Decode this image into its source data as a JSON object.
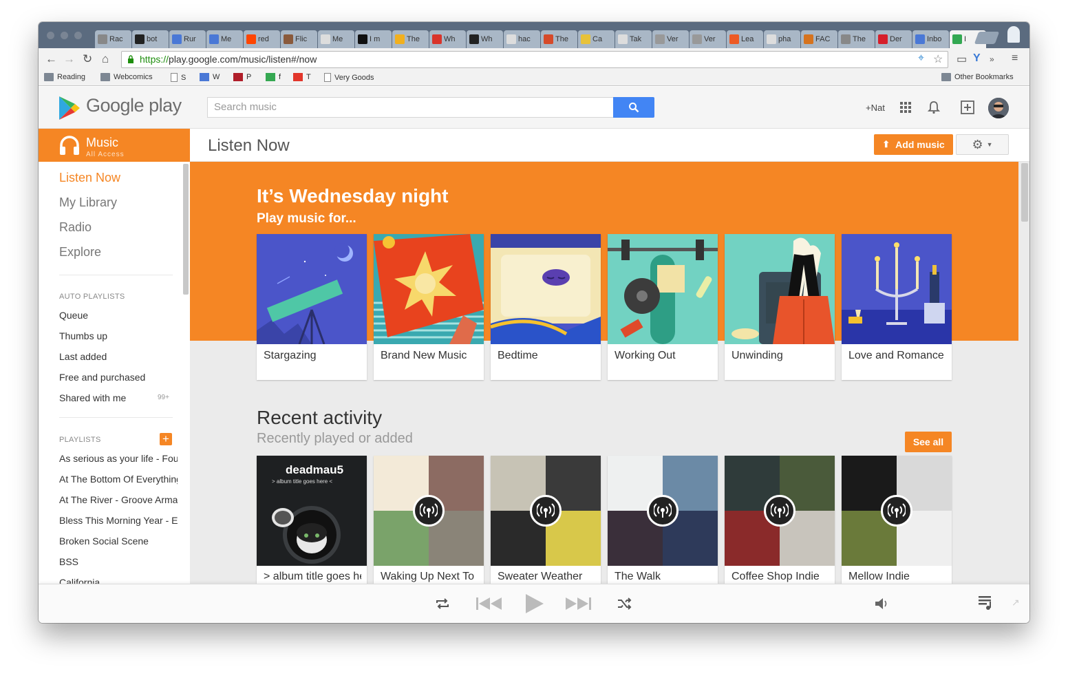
{
  "browser": {
    "tabs": [
      {
        "label": "Rac",
        "fav": "#888888"
      },
      {
        "label": "bot",
        "fav": "#222222"
      },
      {
        "label": "Rur",
        "fav": "#4a78d6"
      },
      {
        "label": "Me",
        "fav": "#4a78d6"
      },
      {
        "label": "red",
        "fav": "#ff4500"
      },
      {
        "label": "Flic",
        "fav": "#8a5a3c"
      },
      {
        "label": "Me",
        "fav": "#dddddd"
      },
      {
        "label": "I m",
        "fav": "#111111"
      },
      {
        "label": "The",
        "fav": "#f2b01e"
      },
      {
        "label": "Wh",
        "fav": "#d9342b"
      },
      {
        "label": "Wh",
        "fav": "#222222"
      },
      {
        "label": "hac",
        "fav": "#dddddd"
      },
      {
        "label": "The",
        "fav": "#d64a2a"
      },
      {
        "label": "Ca",
        "fav": "#e8c23a"
      },
      {
        "label": "Tak",
        "fav": "#dddddd"
      },
      {
        "label": "Ver",
        "fav": "#999999"
      },
      {
        "label": "Ver",
        "fav": "#999999"
      },
      {
        "label": "Lea",
        "fav": "#ee5a24"
      },
      {
        "label": "pha",
        "fav": "#dddddd"
      },
      {
        "label": "FAC",
        "fav": "#d6731e"
      },
      {
        "label": "The",
        "fav": "#888888"
      },
      {
        "label": "Der",
        "fav": "#d61e2a"
      },
      {
        "label": "Inbo",
        "fav": "#4a78d6"
      },
      {
        "label": "I",
        "fav": "#33a852"
      }
    ],
    "url_scheme": "https://",
    "url_rest": "play.google.com/music/listen#/now",
    "bookmarks": [
      {
        "label": "Reading",
        "icon": "folder-icon"
      },
      {
        "label": "Webcomics",
        "icon": "folder-icon"
      },
      {
        "label": "S",
        "icon": "page-icon"
      },
      {
        "label": "W",
        "icon": "doc-icon"
      },
      {
        "label": "P",
        "icon": "red-icon"
      },
      {
        "label": "f",
        "icon": "green-icon"
      },
      {
        "label": "T",
        "icon": "td-icon"
      },
      {
        "label": "Very Goods",
        "icon": "page-icon"
      }
    ],
    "other_bookmarks": "Other Bookmarks"
  },
  "header": {
    "logo_word1": "Google",
    "logo_word2": "play",
    "search_placeholder": "Search music",
    "user_label": "+Nat"
  },
  "music_brand": {
    "name": "Music",
    "sub": "All Access"
  },
  "page_title": "Listen Now",
  "add_music_label": "Add music",
  "sidebar": {
    "nav": [
      "Listen Now",
      "My Library",
      "Radio",
      "Explore"
    ],
    "auto_heading": "AUTO PLAYLISTS",
    "auto": [
      "Queue",
      "Thumbs up",
      "Last added",
      "Free and purchased",
      "Shared with me"
    ],
    "shared_badge": "99+",
    "playlists_heading": "PLAYLISTS",
    "playlists": [
      "As serious as your life - Four Tet",
      "At The Bottom Of Everything",
      "At The River - Groove Armada",
      "Bless This Morning Year - E",
      "Broken Social Scene",
      "BSS",
      "California"
    ]
  },
  "banner": {
    "title": "It’s Wednesday night",
    "subtitle": "Play music for...",
    "cards": [
      "Stargazing",
      "Brand New Music",
      "Bedtime",
      "Working Out",
      "Unwinding",
      "Love and Romance"
    ]
  },
  "recent": {
    "title": "Recent activity",
    "subtitle": "Recently played or added",
    "see_all": "See all",
    "album_text1": "deadmau5",
    "album_text2": "> album title goes here <",
    "cards": [
      "> album title goes here <",
      "Waking Up Next To",
      "Sweater Weather",
      "The Walk",
      "Coffee Shop Indie",
      "Mellow Indie"
    ]
  },
  "colors": {
    "accent": "#f58624",
    "search_blue": "#4285f4"
  }
}
